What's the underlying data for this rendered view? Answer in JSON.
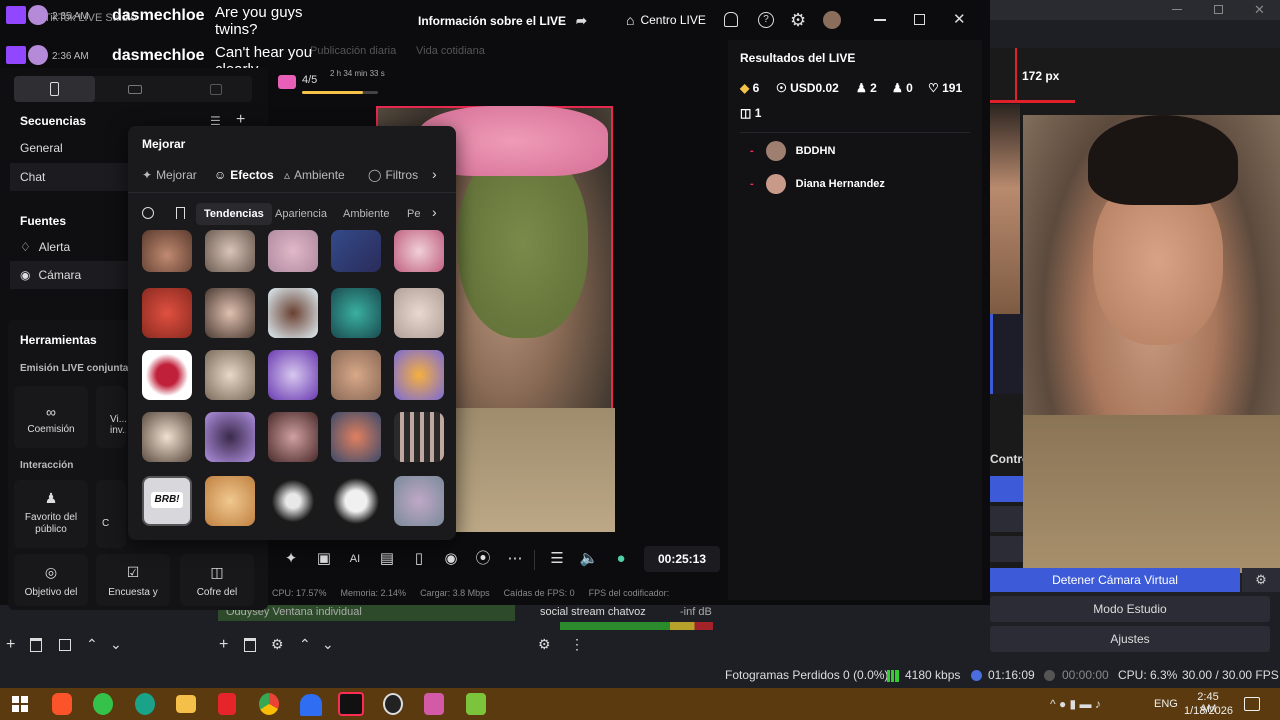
{
  "chat": {
    "messages": [
      {
        "time": "2:35 AM",
        "user": "dasmechloe",
        "text": "Are you guys twins?"
      },
      {
        "time": "2:36 AM",
        "user": "dasmechloe",
        "text": "Can't hear you clearly"
      }
    ]
  },
  "top": {
    "title": "Información sobre el LIVE",
    "center": "Centro LIVE"
  },
  "behind": {
    "app": "TikTok LIVE Studio",
    "sub1": "Publicación diaria",
    "sub2": "Vida cotidiana",
    "progress": "4/5",
    "progress_time": "2 h 34 min 33 s",
    "progress_value": 0.8
  },
  "sidebar": {
    "secuencias": "Secuencias",
    "seq_items": [
      "General",
      "Chat"
    ],
    "fuentes": "Fuentes",
    "sources": [
      "Alerta",
      "Cámara"
    ],
    "herramientas": "Herramientas",
    "emision": "Emisión LIVE conjunta",
    "coemision": "Coemisión",
    "videos": "Vi... inv...",
    "interaccion": "Interacción",
    "favorito": "Favorito del público",
    "obj": "Objetivo del",
    "encuesta": "Encuesta y",
    "cofre": "Cofre del",
    "c_partial": "C"
  },
  "panel": {
    "title": "Mejorar",
    "tabs": [
      "Mejorar",
      "Efectos",
      "Ambiente",
      "Filtros"
    ],
    "active_tab": "Efectos",
    "subtabs": [
      "Tendencias",
      "Apariencia",
      "Ambiente",
      "Pe"
    ],
    "brb": "BRB!"
  },
  "results": {
    "title": "Resultados del LIVE",
    "diamonds": "6",
    "usd": "USD0.02",
    "viewers": "2",
    "new_followers": "0",
    "likes": "191",
    "gifts": "1",
    "users": [
      {
        "name": "BDDHN"
      },
      {
        "name": "Diana Hernandez"
      }
    ]
  },
  "bottombar": {
    "timer": "00:25:13"
  },
  "stats": {
    "cpu": "CPU: 17.57%",
    "mem": "Memoria: 2.14%",
    "load": "Cargar: 3.8 Mbps",
    "fps_drops": "Caídas de FPS: 0",
    "encoder": "FPS del codificador:"
  },
  "obs": {
    "px": "172 px",
    "controls": "Contro",
    "stop_cam": "Detener Cámara Virtual",
    "studio": "Modo Estudio",
    "settings": "Ajustes",
    "scene_item": "Oddysey Ventana individual",
    "mixer_item": "social stream chatvoz",
    "mixer_db": "-inf dB",
    "status_frames": "Fotogramas Perdidos 0 (0.0%)",
    "status_kbps": "4180 kbps",
    "status_live": "01:16:09",
    "status_rec": "00:00:00",
    "status_cpu": "CPU: 6.3%",
    "status_fps": "30.00 / 30.00 FPS"
  },
  "taskbar": {
    "time": "2:45 AM",
    "date": "1/13/2026",
    "lang": "ENG"
  },
  "colors": {
    "accent": "#fe2c55",
    "obs_blue": "#3d5bd8"
  }
}
